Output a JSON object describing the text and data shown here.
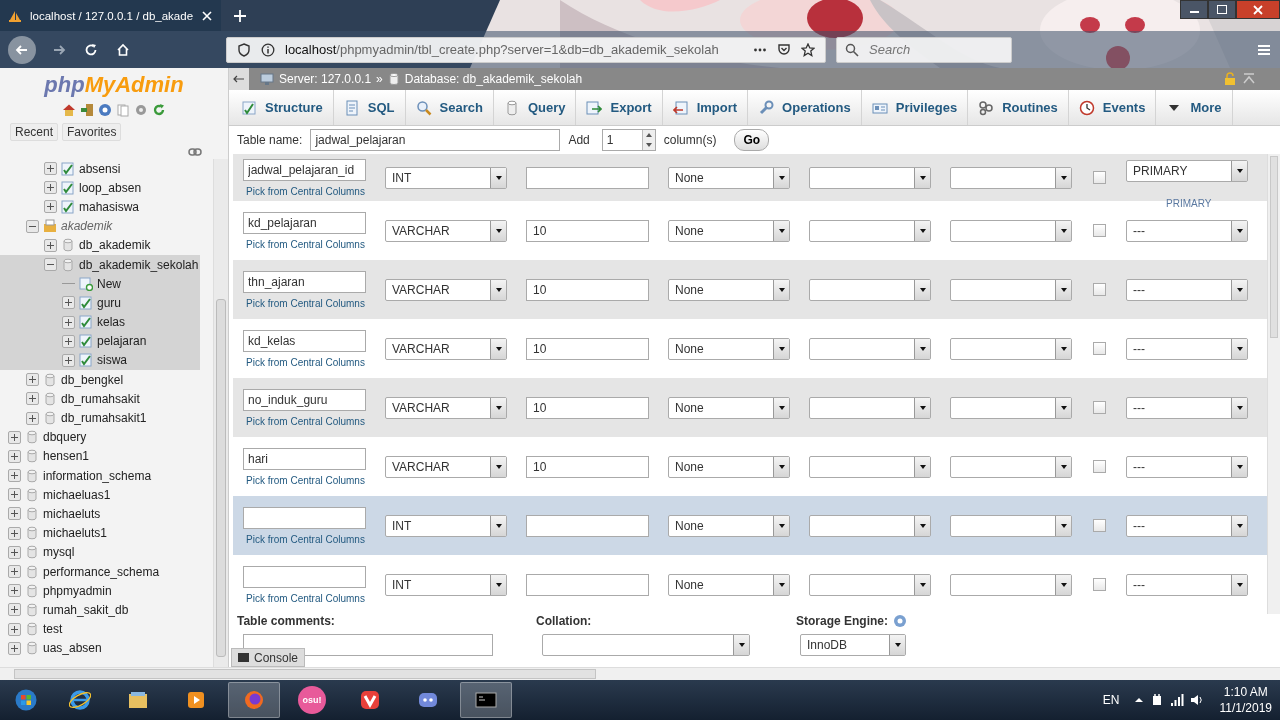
{
  "browser": {
    "tab_title": "localhost / 127.0.0.1 / db_akade",
    "url_host": "localhost",
    "url_path": "/phpmyadmin/tbl_create.php?server=1&db=db_akademik_sekolah",
    "search_placeholder": "Search"
  },
  "sidebar": {
    "logo_prefix": "php",
    "logo_suffix": "MyAdmin",
    "buttons": [
      "Recent",
      "Favorites"
    ],
    "tree": [
      {
        "children": [
          {
            "children": [
              {
                "kind": "table",
                "label": "absensi",
                "expanded": false,
                "selected": false
              },
              {
                "kind": "table",
                "label": "loop_absen",
                "expanded": false,
                "selected": false
              },
              {
                "kind": "table",
                "label": "mahasiswa",
                "expanded": false,
                "selected": false
              }
            ]
          },
          {
            "kind": "group",
            "label": "akademik",
            "expanded": true,
            "selected": false,
            "children": [
              {
                "kind": "db",
                "label": "db_akademik",
                "expanded": false,
                "selected": false
              },
              {
                "kind": "db",
                "label": "db_akademik_sekolah",
                "expanded": true,
                "selected": true,
                "children": [
                  {
                    "kind": "new",
                    "label": "New",
                    "selected": true
                  },
                  {
                    "kind": "table",
                    "label": "guru",
                    "expanded": false,
                    "selected": true
                  },
                  {
                    "kind": "table",
                    "label": "kelas",
                    "expanded": false,
                    "selected": true
                  },
                  {
                    "kind": "table",
                    "label": "pelajaran",
                    "expanded": false,
                    "selected": true
                  },
                  {
                    "kind": "table",
                    "label": "siswa",
                    "expanded": false,
                    "selected": true
                  }
                ]
              }
            ]
          },
          {
            "kind": "db",
            "label": "db_bengkel",
            "expanded": false,
            "selected": false
          },
          {
            "kind": "db",
            "label": "db_rumahsakit",
            "expanded": false,
            "selected": false
          },
          {
            "kind": "db",
            "label": "db_rumahsakit1",
            "expanded": false,
            "selected": false
          }
        ]
      },
      {
        "kind": "db",
        "label": "dbquery",
        "expanded": false,
        "selected": false
      },
      {
        "kind": "db",
        "label": "hensen1",
        "expanded": false,
        "selected": false
      },
      {
        "kind": "db",
        "label": "information_schema",
        "expanded": false,
        "selected": false
      },
      {
        "kind": "db",
        "label": "michaeluas1",
        "expanded": false,
        "selected": false
      },
      {
        "kind": "db",
        "label": "michaeluts",
        "expanded": false,
        "selected": false
      },
      {
        "kind": "db",
        "label": "michaeluts1",
        "expanded": false,
        "selected": false
      },
      {
        "kind": "db",
        "label": "mysql",
        "expanded": false,
        "selected": false
      },
      {
        "kind": "db",
        "label": "performance_schema",
        "expanded": false,
        "selected": false
      },
      {
        "kind": "db",
        "label": "phpmyadmin",
        "expanded": false,
        "selected": false
      },
      {
        "kind": "db",
        "label": "rumah_sakit_db",
        "expanded": false,
        "selected": false
      },
      {
        "kind": "db",
        "label": "test",
        "expanded": false,
        "selected": false
      },
      {
        "kind": "db",
        "label": "uas_absen",
        "expanded": false,
        "selected": false
      }
    ]
  },
  "breadcrumb": {
    "server": "Server: 127.0.0.1",
    "separator": "»",
    "database": "Database: db_akademik_sekolah"
  },
  "tabs": [
    {
      "label": "Structure",
      "kind": "structure"
    },
    {
      "label": "SQL",
      "kind": "sql"
    },
    {
      "label": "Search",
      "kind": "search"
    },
    {
      "label": "Query",
      "kind": "query"
    },
    {
      "label": "Export",
      "kind": "export"
    },
    {
      "label": "Import",
      "kind": "import"
    },
    {
      "label": "Operations",
      "kind": "operations"
    },
    {
      "label": "Privileges",
      "kind": "privileges"
    },
    {
      "label": "Routines",
      "kind": "routines"
    },
    {
      "label": "Events",
      "kind": "events"
    },
    {
      "label": "More",
      "kind": "more"
    }
  ],
  "table_form": {
    "name_label": "Table name:",
    "name_value": "jadwal_pelajaran",
    "add_label": "Add",
    "add_value": "1",
    "columns_label": "column(s)",
    "go_button": "Go"
  },
  "columns": [
    {
      "name": "jadwal_pelajaran_id",
      "type": "INT",
      "default": "None",
      "null": false,
      "index": "PRIMARY",
      "index_note": "PRIMARY",
      "link": "Pick from Central Columns",
      "highlighted": false
    },
    {
      "name": "kd_pelajaran",
      "type": "VARCHAR",
      "length": "10",
      "default": "None",
      "null": false,
      "index": "---",
      "link": "Pick from Central Columns",
      "highlighted": false
    },
    {
      "name": "thn_ajaran",
      "type": "VARCHAR",
      "length": "10",
      "default": "None",
      "null": false,
      "index": "---",
      "link": "Pick from Central Columns",
      "highlighted": false
    },
    {
      "name": "kd_kelas",
      "type": "VARCHAR",
      "length": "10",
      "default": "None",
      "null": false,
      "index": "---",
      "link": "Pick from Central Columns",
      "highlighted": false
    },
    {
      "name": "no_induk_guru",
      "type": "VARCHAR",
      "length": "10",
      "default": "None",
      "null": false,
      "index": "---",
      "link": "Pick from Central Columns",
      "highlighted": false
    },
    {
      "name": "hari",
      "type": "VARCHAR",
      "length": "10",
      "default": "None",
      "null": false,
      "index": "---",
      "link": "Pick from Central Columns",
      "highlighted": false
    },
    {
      "type": "INT",
      "default": "None",
      "null": false,
      "index": "---",
      "link": "Pick from Central Columns",
      "highlighted": true
    },
    {
      "type": "INT",
      "default": "None",
      "null": false,
      "index": "---",
      "link": "Pick from Central Columns",
      "highlighted": false
    }
  ],
  "footer": {
    "comments_label": "Table comments:",
    "collation_label": "Collation:",
    "engine_label": "Storage Engine:",
    "engine_value": "InnoDB",
    "console": "Console"
  },
  "taskbar": {
    "apps": [
      {
        "kind": "ie",
        "active": false
      },
      {
        "kind": "explorer",
        "active": false
      },
      {
        "kind": "media",
        "active": false
      },
      {
        "kind": "firefox",
        "active": true
      },
      {
        "kind": "osu",
        "label": "osu!",
        "active": false
      },
      {
        "kind": "vivaldi",
        "active": false
      },
      {
        "kind": "discord",
        "active": false
      },
      {
        "kind": "cmd",
        "active": true
      }
    ],
    "language": "EN",
    "time": "1:10 AM",
    "date": "11/1/2019"
  }
}
